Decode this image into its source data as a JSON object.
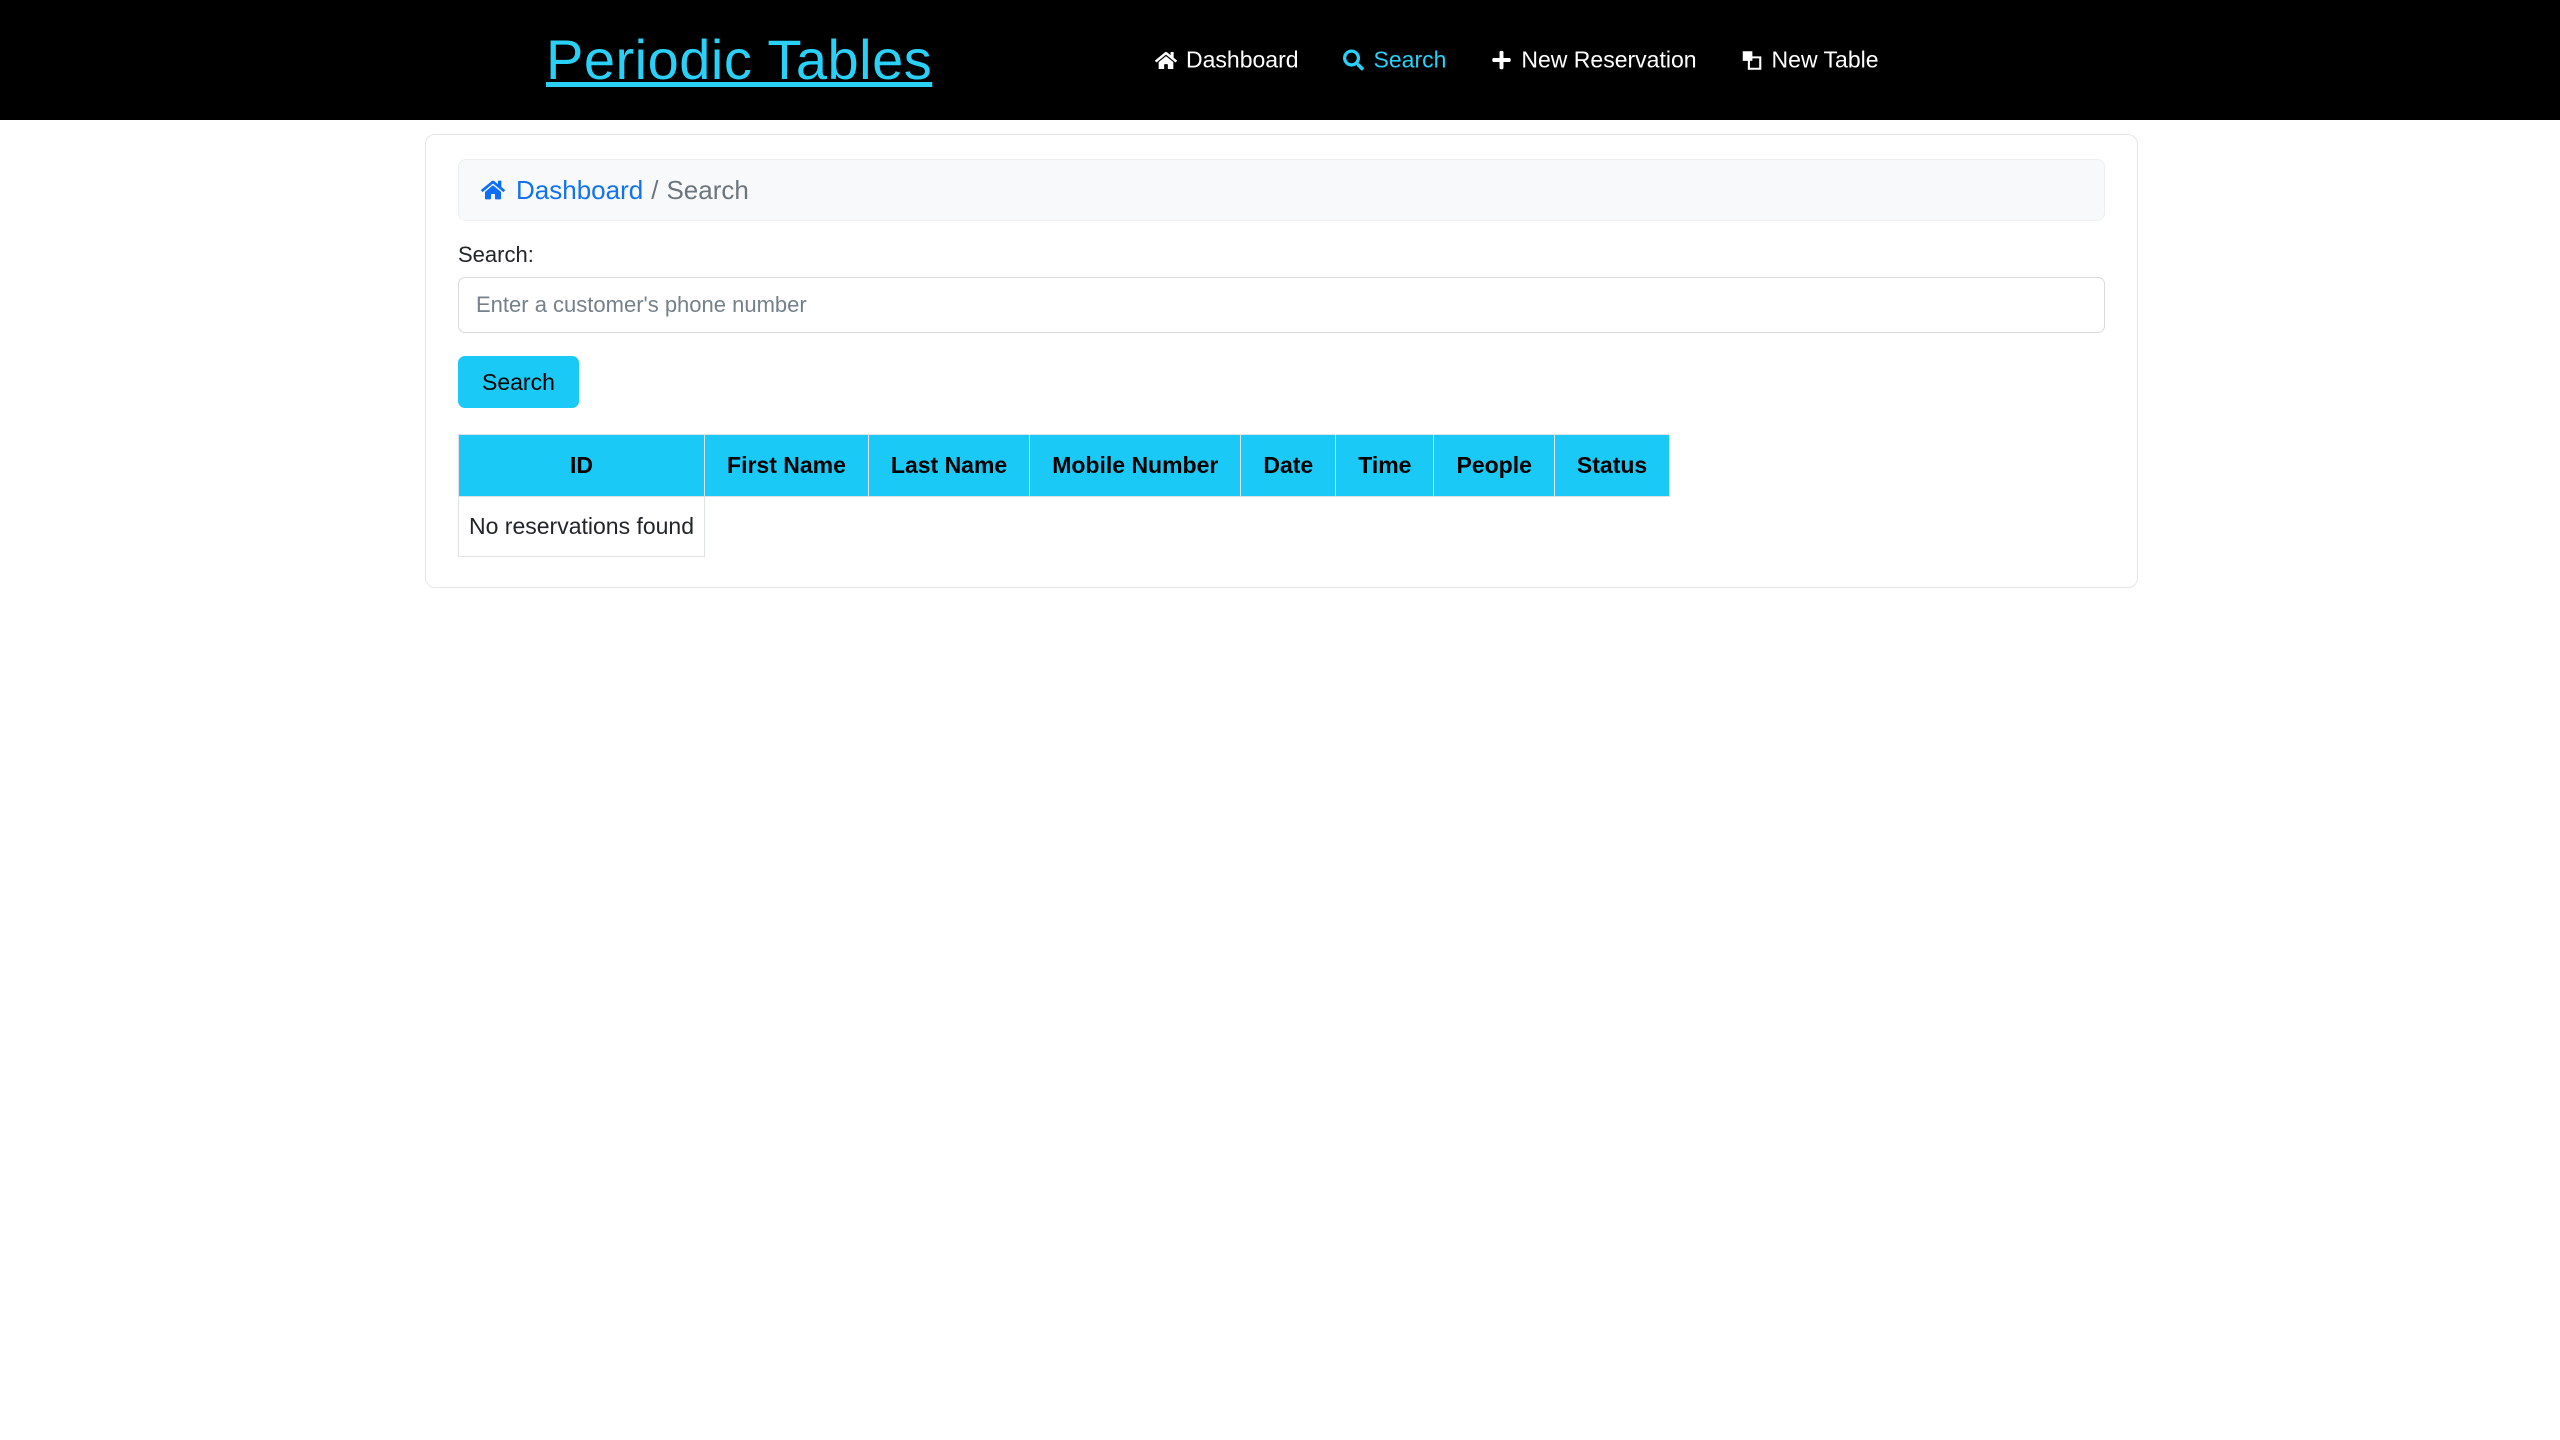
{
  "header": {
    "brand": "Periodic Tables",
    "brand_color": "#29d0f7",
    "background": "#000000",
    "nav": [
      {
        "label": "Dashboard",
        "icon": "home-icon",
        "active": false
      },
      {
        "label": "Search",
        "icon": "search-icon",
        "active": true
      },
      {
        "label": "New Reservation",
        "icon": "plus-icon",
        "active": false
      },
      {
        "label": "New Table",
        "icon": "new-table-icon",
        "active": false
      }
    ]
  },
  "breadcrumb": {
    "home_icon": "home-icon",
    "link_label": "Dashboard",
    "separator": "/",
    "current": "Search",
    "link_color": "#1272f0",
    "current_color": "#6c757d"
  },
  "search": {
    "label": "Search:",
    "placeholder": "Enter a customer's phone number",
    "value": "",
    "button_label": "Search",
    "button_color": "#1ac9f5"
  },
  "results": {
    "accent_color": "#1ac9f5",
    "columns": [
      "ID",
      "First Name",
      "Last Name",
      "Mobile Number",
      "Date",
      "Time",
      "People",
      "Status"
    ],
    "rows": [],
    "empty_message": "No reservations found"
  }
}
